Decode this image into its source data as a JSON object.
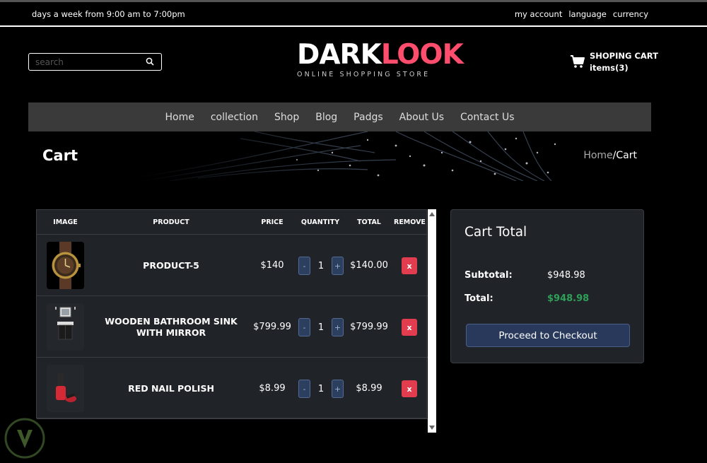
{
  "topbar": {
    "hours": "days a week from 9:00 am to 7:00pm",
    "links": [
      "my account",
      "language",
      "currency"
    ]
  },
  "search": {
    "placeholder": "search",
    "icon": "search-icon"
  },
  "logo": {
    "part1": "DARK",
    "part2": "LOOK",
    "tagline": "ONLINE SHOPPING STORE",
    "accent": "#ff4d6d"
  },
  "cart": {
    "label": "SHOPING CART",
    "items": "items(3)",
    "icon": "cart-icon"
  },
  "nav": [
    "Home",
    "collection",
    "Shop",
    "Blog",
    "Padgs",
    "About Us",
    "Contact Us"
  ],
  "banner": {
    "title": "Cart",
    "crumb_home": "Home",
    "crumb_sep": "/",
    "crumb_current": "Cart"
  },
  "table": {
    "headers": [
      "IMAGE",
      "PRODUCT",
      "PRICE",
      "QUANTITY",
      "TOTAL",
      "REMOVE"
    ],
    "rows": [
      {
        "product": "PRODUCT-5",
        "price": "$140",
        "qty": "1",
        "total": "$140.00",
        "remove": "x",
        "image": "watch"
      },
      {
        "product": "WOODEN BATHROOM SINK WITH MIRROR",
        "price": "$799.99",
        "qty": "1",
        "total": "$799.99",
        "remove": "x",
        "image": "sink"
      },
      {
        "product": "RED NAIL POLISH",
        "price": "$8.99",
        "qty": "1",
        "total": "$8.99",
        "remove": "x",
        "image": "nail-polish"
      }
    ],
    "minus": "-",
    "plus": "+"
  },
  "totals": {
    "title": "Cart Total",
    "subtotal_label": "Subtotal:",
    "subtotal_value": "$948.98",
    "total_label": "Total:",
    "total_value": "$948.98",
    "checkout_label": "Proceed to Checkout",
    "total_color": "#2fa058"
  }
}
